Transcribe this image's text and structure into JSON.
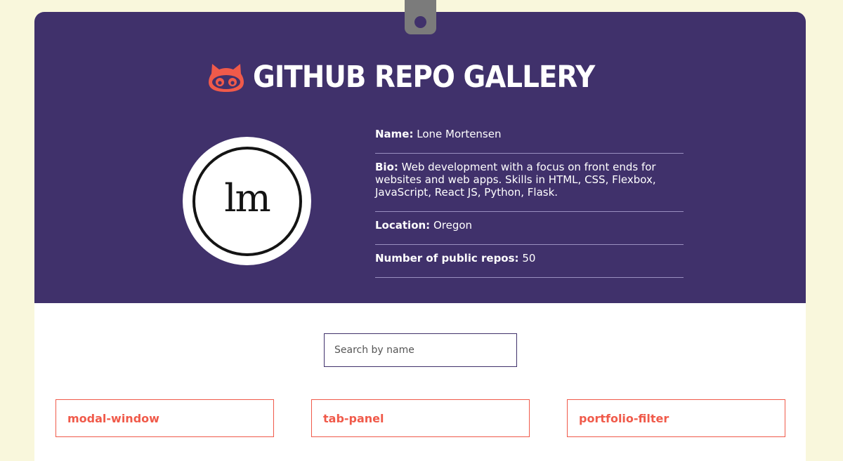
{
  "header": {
    "title": "GitHub Repo Gallery",
    "logo_icon": "github-octocat-icon",
    "accent_color": "#f05a4a",
    "header_bg": "#40316b"
  },
  "profile": {
    "avatar_text": "lm",
    "name_label": "Name:",
    "name_value": " Lone Mortensen",
    "bio_label": "Bio:",
    "bio_value": " Web development with a focus on front ends for websites and web apps. Skills in HTML, CSS, Flexbox, JavaScript, React JS, Python, Flask.",
    "location_label": "Location:",
    "location_value": " Oregon",
    "repos_label": "Number of public repos:",
    "repos_value": " 50"
  },
  "search": {
    "placeholder": "Search by name",
    "value": ""
  },
  "repos": [
    {
      "name": "modal-window"
    },
    {
      "name": "tab-panel"
    },
    {
      "name": "portfolio-filter"
    }
  ]
}
